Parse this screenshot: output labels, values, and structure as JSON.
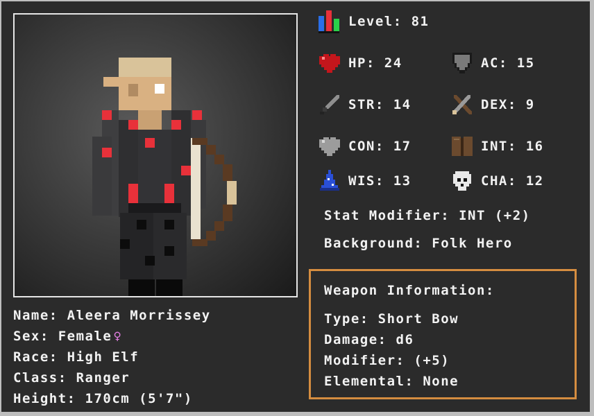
{
  "character": {
    "name_label": "Name:",
    "name": "Aleera Morrissey",
    "sex_label": "Sex:",
    "sex": "Female",
    "sex_symbol": "♀",
    "race_label": "Race:",
    "race": "High Elf",
    "class_label": "Class:",
    "class": "Ranger",
    "height_label": "Height:",
    "height": "170cm (5'7\")"
  },
  "stats": {
    "level_label": "Level:",
    "level": "81",
    "hp_label": "HP:",
    "hp": "24",
    "ac_label": "AC:",
    "ac": "15",
    "str_label": "STR:",
    "str": "14",
    "dex_label": "DEX:",
    "dex": "9",
    "con_label": "CON:",
    "con": "17",
    "int_label": "INT:",
    "int": "16",
    "wis_label": "WIS:",
    "wis": "13",
    "cha_label": "CHA:",
    "cha": "12"
  },
  "stat_modifier": {
    "label": "Stat Modifier:",
    "value": "INT (+2)"
  },
  "background": {
    "label": "Background:",
    "value": "Folk Hero"
  },
  "weapon": {
    "title": "Weapon Information:",
    "type_label": "Type:",
    "type": "Short Bow",
    "damage_label": "Damage:",
    "damage": "d6",
    "modifier_label": "Modifier:",
    "modifier": "(+5)",
    "elemental_label": "Elemental:",
    "elemental": "None"
  },
  "colors": {
    "panel_bg": "#2b2b2b",
    "text": "#f2f2f2",
    "weapon_border": "#d58d40",
    "accent_red": "#e8313a",
    "female_symbol": "#e57fe5"
  },
  "icons": {
    "level": "level-bars-icon",
    "hp": "heart-icon",
    "ac": "shield-icon",
    "str": "sword-icon",
    "dex": "crossed-tools-icon",
    "con": "gray-heart-icon",
    "int": "book-icon",
    "wis": "wizard-hat-icon",
    "cha": "skull-icon"
  }
}
